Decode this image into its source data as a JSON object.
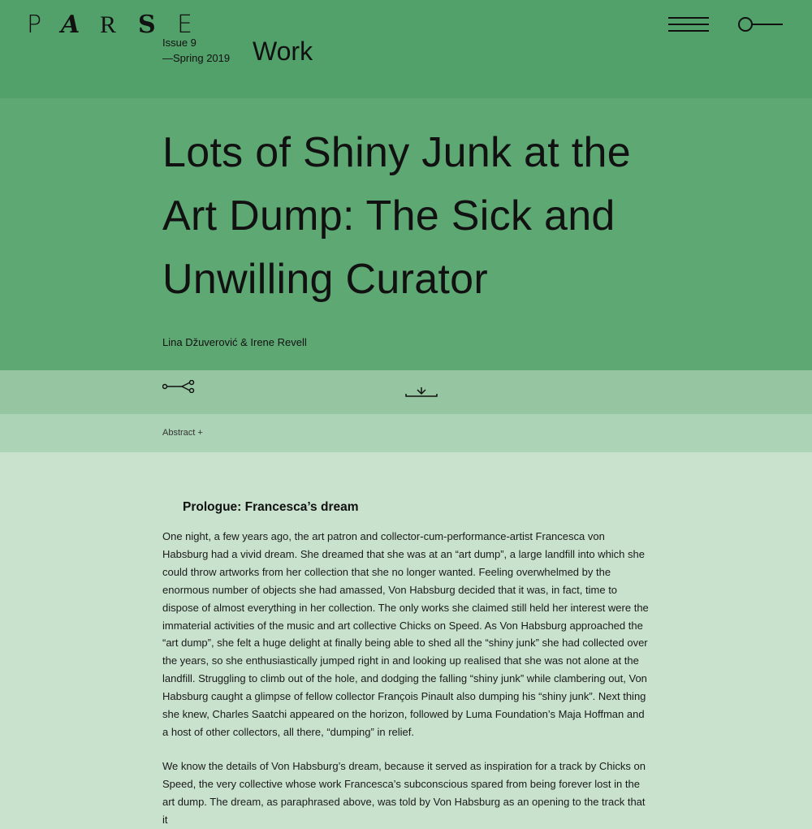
{
  "header": {
    "logo_letters": [
      "P",
      "A",
      "R",
      "S",
      "E"
    ],
    "issue": "Issue 9",
    "season": "—Spring 2019",
    "section": "Work",
    "menu_icon": "hamburger-menu-icon",
    "search_icon": "search-icon"
  },
  "article": {
    "title": "Lots of Shiny Junk at the Art Dump: The Sick and Unwilling Curator",
    "authors": "Lina Džuverović & Irene Revell",
    "share_icon": "share-icon",
    "download_icon": "download-icon",
    "abstract_toggle": "Abstract +",
    "subheading": "Prologue: Francesca’s dream",
    "paragraphs": [
      "One night, a few years ago, the art patron and collector-cum-performance-artist Francesca von Habsburg had a vivid dream. She dreamed that she was at an “art dump”, a large landfill into which she could throw artworks from her collection that she no longer wanted. Feeling overwhelmed by the enormous number of objects she had amassed, Von Habsburg decided that it was, in fact, time to dispose of almost everything in her collection. The only works she claimed still held her interest were the immaterial activities of the music and art collective Chicks on Speed. As Von Habsburg approached the “art dump”, she felt a huge delight at finally being able to shed all the “shiny junk” she had collected over the years, so she enthusiastically jumped right in and looking up realised that she was not alone at the landfill. Struggling to climb out of the hole, and dodging the falling “shiny junk” while clambering out, Von Habsburg caught a glimpse of fellow collector François Pinault also dumping his “shiny junk”. Next thing she knew, Charles Saatchi appeared on the horizon, followed by Luma Foundation’s Maja Hoffman and a host of other collectors, all there, “dumping” in relief.",
      "We know the details of Von Habsburg’s dream, because it served as inspiration for a track by Chicks on Speed, the very collective whose work Francesca’s subconscious spared from being forever lost in the art dump. The dream, as paraphrased above, was told by Von Habsburg as an opening to the track that it"
    ]
  },
  "colors": {
    "header_bg": "#52a06a",
    "hero_bg": "#5ea874",
    "tools_bg": "#96c6a1",
    "abstract_bg": "#acd3b5",
    "content_bg": "#c9e2cd",
    "text": "#111111"
  }
}
